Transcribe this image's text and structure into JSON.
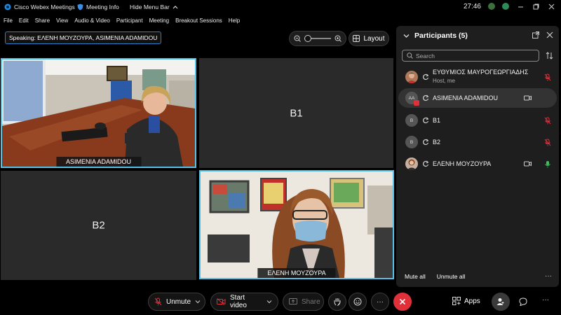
{
  "titlebar": {
    "app_title": "Cisco Webex Meetings",
    "meeting_info": "Meeting Info",
    "hide_menu_bar": "Hide Menu Bar",
    "clock": "27:46"
  },
  "menu": [
    "File",
    "Edit",
    "Share",
    "View",
    "Audio & Video",
    "Participant",
    "Meeting",
    "Breakout Sessions",
    "Help"
  ],
  "speaking": "Speaking: ΕΛΕΝΗ ΜΟΥΖΟΥΡΑ, ASIMENIA ADAMIDOU",
  "layout_label": "Layout",
  "tiles": {
    "t1_name": "ASIMENIA ADAMIDOU",
    "t2_label": "B1",
    "t3_label": "B2",
    "t4_name": "ΕΛΕΝΗ ΜΟΥΖΟΥΡΑ"
  },
  "participants": {
    "title": "Participants (5)",
    "search_placeholder": "Search",
    "list": [
      {
        "name": "ΕΥΘΥΜΙΟΣ ΜΑΥΡΟΓΕΩΡΓΙΑΔΗΣ",
        "sub": "Host, me",
        "avatar": "",
        "status": "mic-muted-icon"
      },
      {
        "name": "ASIMENIA ADAMIDOU",
        "sub": "",
        "avatar": "AA",
        "status": "camera-icon"
      },
      {
        "name": "B1",
        "sub": "",
        "avatar": "B",
        "status": "mic-muted-icon"
      },
      {
        "name": "B2",
        "sub": "",
        "avatar": "B",
        "status": "mic-muted-icon"
      },
      {
        "name": "ΕΛΕΝΗ ΜΟΥΖΟΥΡΑ",
        "sub": "",
        "avatar": "",
        "status": "camera-icon"
      }
    ],
    "mute_all": "Mute all",
    "unmute_all": "Unmute all"
  },
  "toolbar": {
    "unmute": "Unmute",
    "start_video": "Start video",
    "share": "Share",
    "apps": "Apps"
  },
  "colors": {
    "accent": "#54c1e9",
    "end_call": "#e0303a",
    "muted": "#e0303a",
    "active_mic": "#3fbf5f"
  }
}
